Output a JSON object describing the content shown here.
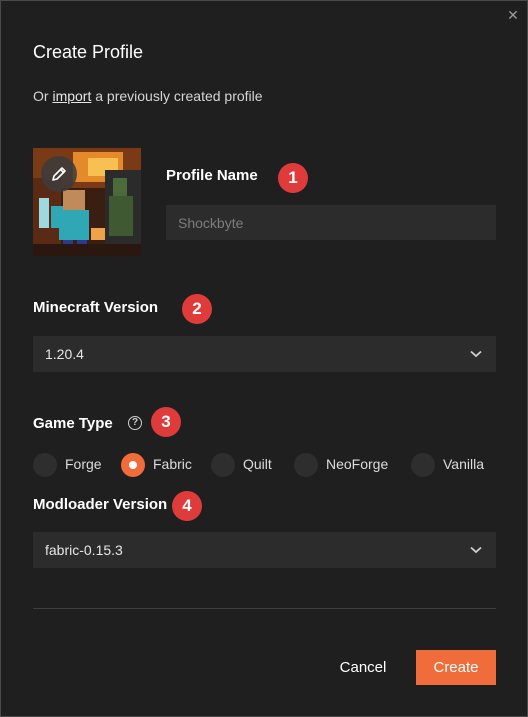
{
  "dialog": {
    "title": "Create Profile",
    "subtitle_prefix": "Or",
    "subtitle_link": "import",
    "subtitle_suffix": "a previously created profile",
    "close_icon": "close-icon"
  },
  "profile_name": {
    "label": "Profile Name",
    "placeholder": "Shockbyte",
    "value": "",
    "step": "1"
  },
  "minecraft_version": {
    "label": "Minecraft Version",
    "selected": "1.20.4",
    "step": "2"
  },
  "game_type": {
    "label": "Game Type",
    "help_icon": "?",
    "step": "3",
    "options": [
      "Forge",
      "Fabric",
      "Quilt",
      "NeoForge",
      "Vanilla"
    ],
    "selected": "Fabric"
  },
  "modloader_version": {
    "label": "Modloader Version",
    "selected": "fabric-0.15.3",
    "step": "4"
  },
  "buttons": {
    "cancel": "Cancel",
    "create": "Create"
  },
  "colors": {
    "accent": "#f06d3b",
    "step_badge": "#e03b3b",
    "background": "#1f1f1f",
    "field": "#2c2c2c"
  }
}
